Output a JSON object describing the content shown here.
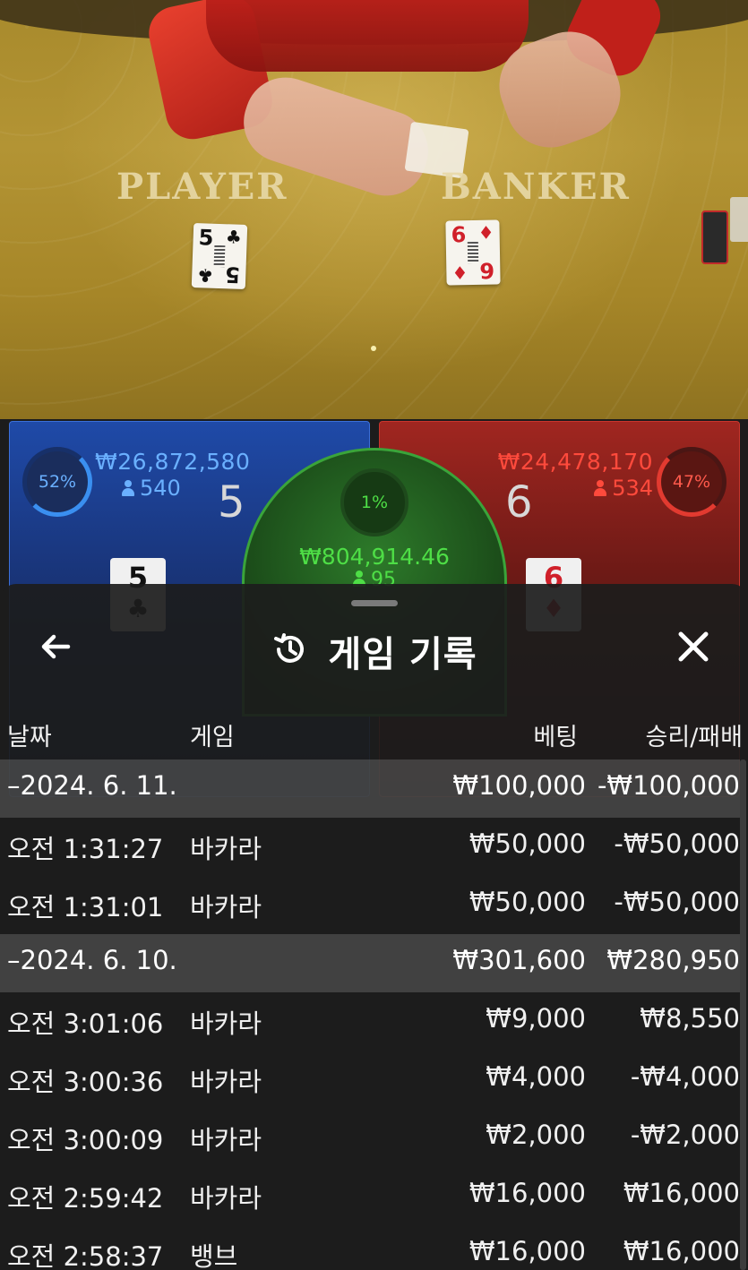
{
  "table": {
    "player_label": "PLAYER",
    "banker_label": "BANKER",
    "player_card": {
      "rank": "5",
      "suit": "♣"
    },
    "banker_card": {
      "rank": "6",
      "suit": "♦"
    }
  },
  "player": {
    "percent": "52%",
    "amount": "₩26,872,580",
    "count": "540",
    "score": "5",
    "card": {
      "rank": "5",
      "suit": "♣"
    }
  },
  "banker": {
    "percent": "47%",
    "amount": "₩24,478,170",
    "count": "534",
    "score": "6",
    "card": {
      "rank": "6",
      "suit": "♦"
    }
  },
  "tie": {
    "percent": "1%",
    "amount": "₩804,914.46",
    "count": "95"
  },
  "sheet": {
    "title": "게임 기록",
    "columns": {
      "date": "날짜",
      "game": "게임",
      "bet": "베팅",
      "win_loss": "승리/패배"
    },
    "rows": [
      {
        "type": "group",
        "date": "–2024. 6. 11.",
        "game": "",
        "bet": "₩100,000",
        "win_loss": "-₩100,000"
      },
      {
        "type": "item",
        "date": "오전 1:31:27",
        "game": "바카라",
        "bet": "₩50,000",
        "win_loss": "-₩50,000"
      },
      {
        "type": "item",
        "date": "오전 1:31:01",
        "game": "바카라",
        "bet": "₩50,000",
        "win_loss": "-₩50,000"
      },
      {
        "type": "group",
        "date": "–2024. 6. 10.",
        "game": "",
        "bet": "₩301,600",
        "win_loss": "₩280,950"
      },
      {
        "type": "item",
        "date": "오전 3:01:06",
        "game": "바카라",
        "bet": "₩9,000",
        "win_loss": "₩8,550"
      },
      {
        "type": "item",
        "date": "오전 3:00:36",
        "game": "바카라",
        "bet": "₩4,000",
        "win_loss": "-₩4,000"
      },
      {
        "type": "item",
        "date": "오전 3:00:09",
        "game": "바카라",
        "bet": "₩2,000",
        "win_loss": "-₩2,000"
      },
      {
        "type": "item",
        "date": "오전 2:59:42",
        "game": "바카라",
        "bet": "₩16,000",
        "win_loss": "₩16,000"
      },
      {
        "type": "item",
        "date": "오전 2:58:37",
        "game": "뱅브",
        "bet": "₩16,000",
        "win_loss": "₩16,000"
      }
    ]
  },
  "icons": {
    "back": "arrow-left-icon",
    "history": "history-clock-icon",
    "close": "close-icon"
  },
  "colors": {
    "player": "#3a8ff0",
    "banker": "#e23a30",
    "tie": "#4ede46",
    "sheet_bg": "#1c1c1c"
  }
}
